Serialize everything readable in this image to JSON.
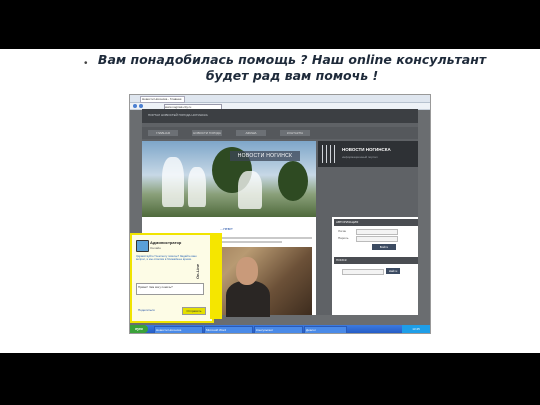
{
  "slide": {
    "bullet": "•",
    "line1": "Вам понадобилась помощь ? Наш online консультант",
    "line2": "будет рад вам помочь !"
  },
  "browser": {
    "tab_title": "Новости Ногинска - Главная",
    "address": "www.noginsk-city.ru"
  },
  "site": {
    "top_text": "ПОРТАЛ НОВОСТЕЙ ГОРОДА НОГИНСКА",
    "banner_title": "НОВОСТИ НОГИНСК",
    "news_title": "НОВОСТИ НОГИНСКА",
    "news_sub": "информационный портал",
    "news_link": "...нем»",
    "nav": [
      "ГЛАВНАЯ",
      "НОВОСТИ ГОРОДА",
      "АФИША",
      "КОНТАКТЫ"
    ],
    "sidebar": {
      "auth_head": "АВТОРИЗАЦИЯ",
      "login_label": "Логин",
      "password_label": "Пароль",
      "enter_button": "Войти",
      "search_head": "ПОИСК",
      "search_button": "Найти"
    }
  },
  "chat": {
    "operator_title": "Администратор",
    "operator_status": "Онлайн",
    "message": "Здравствуйте! Чем могу помочь? Задайте ваш вопрос, и мы ответим в ближайшее время.",
    "input_text": "Привет! Чем могу помочь?",
    "send_button": "Отправить",
    "link": "Поделиться",
    "side_tab": "On-Line"
  },
  "taskbar": {
    "start": "пуск",
    "tasks": [
      "Новости Ногинска",
      "Microsoft Word",
      "Консультант",
      "Диалог"
    ],
    "clock": "13:45"
  }
}
